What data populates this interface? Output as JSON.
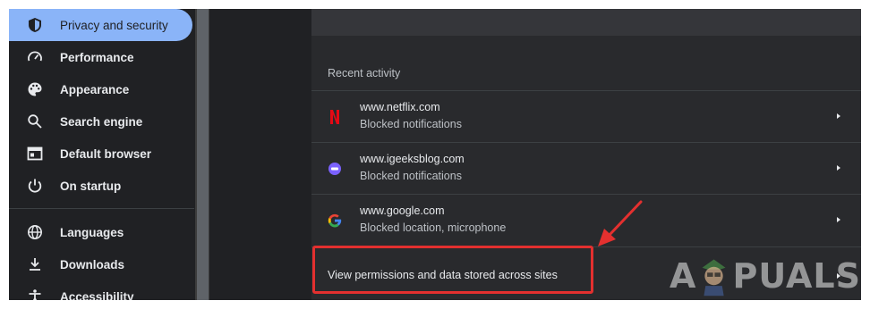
{
  "sidebar": {
    "items": [
      {
        "label": "Privacy and security",
        "icon": "shield-icon",
        "active": true
      },
      {
        "label": "Performance",
        "icon": "speedometer-icon"
      },
      {
        "label": "Appearance",
        "icon": "palette-icon"
      },
      {
        "label": "Search engine",
        "icon": "search-icon"
      },
      {
        "label": "Default browser",
        "icon": "browser-window-icon"
      },
      {
        "label": "On startup",
        "icon": "power-icon"
      },
      {
        "label": "Languages",
        "icon": "globe-icon"
      },
      {
        "label": "Downloads",
        "icon": "download-icon"
      },
      {
        "label": "Accessibility",
        "icon": "accessibility-icon"
      }
    ]
  },
  "main": {
    "recent_heading": "Recent activity",
    "sites": [
      {
        "name": "www.netflix.com",
        "status": "Blocked notifications",
        "favicon": "netflix-favicon",
        "favicon_color": "#e50914"
      },
      {
        "name": "www.igeeksblog.com",
        "status": "Blocked notifications",
        "favicon": "igeeksblog-favicon",
        "favicon_color": "#7b61ff"
      },
      {
        "name": "www.google.com",
        "status": "Blocked location, microphone",
        "favicon": "google-favicon"
      }
    ],
    "view_permissions_label": "View permissions and data stored across sites"
  },
  "colors": {
    "background": "#202124",
    "card": "#292a2d",
    "active_item": "#8ab4f8",
    "annotation": "#e3302f"
  },
  "watermark": {
    "text_left": "A",
    "text_right": "PUALS"
  }
}
